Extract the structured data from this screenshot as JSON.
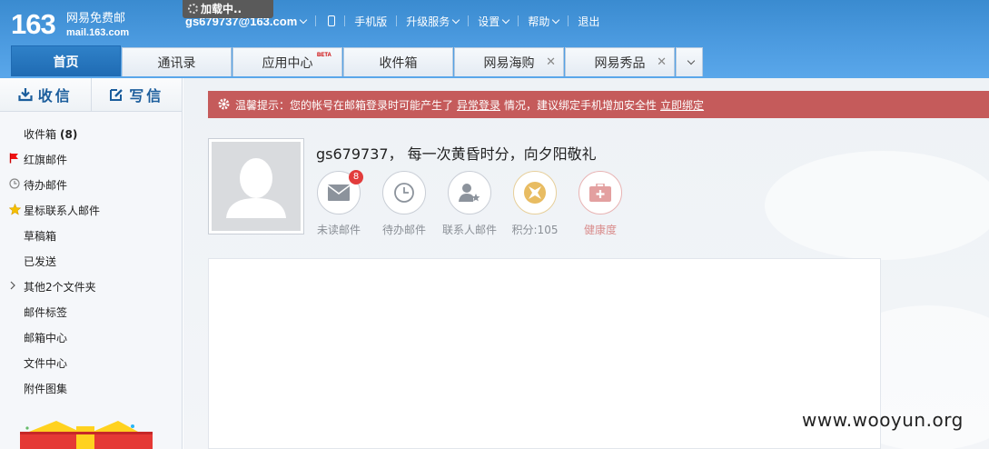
{
  "logo": {
    "number": "163",
    "name": "网易免费邮",
    "domain": "mail.163.com"
  },
  "loading": {
    "label": "加载中.."
  },
  "topnav": {
    "account": "gs679737@163.com",
    "mobile": "手机版",
    "upgrade": "升级服务",
    "settings": "设置",
    "help": "帮助",
    "logout": "退出"
  },
  "tabs": [
    {
      "label": "首页",
      "active": true
    },
    {
      "label": "通讯录"
    },
    {
      "label": "应用中心",
      "badge": "BETA"
    },
    {
      "label": "收件箱"
    },
    {
      "label": "网易海购",
      "closable": true
    },
    {
      "label": "网易秀品",
      "closable": true
    }
  ],
  "sidebar": {
    "receive": "收信",
    "compose": "写信",
    "folders": [
      {
        "label": "收件箱",
        "count": "(8)"
      },
      {
        "label": "红旗邮件"
      },
      {
        "label": "待办邮件"
      },
      {
        "label": "星标联系人邮件"
      },
      {
        "label": "草稿箱"
      },
      {
        "label": "已发送"
      },
      {
        "label": "其他2个文件夹"
      },
      {
        "label": "邮件标签"
      },
      {
        "label": "邮箱中心"
      },
      {
        "label": "文件中心"
      },
      {
        "label": "附件图集"
      }
    ]
  },
  "notice": {
    "prefix": "温馨提示：您的帐号在邮箱登录时可能产生了",
    "link1": "异常登录",
    "middle": "情况，建议绑定手机增加安全性",
    "link2": "立即绑定"
  },
  "profile": {
    "greeting": "gs679737， 每一次黄昏时分，向夕阳敬礼",
    "stats": [
      {
        "label": "未读邮件",
        "badge": "8"
      },
      {
        "label": "待办邮件"
      },
      {
        "label": "联系人邮件"
      },
      {
        "label": "积分:105"
      },
      {
        "label": "健康度"
      }
    ]
  },
  "watermark": "www.wooyun.org",
  "colors": {
    "header": "#3a8bd0",
    "notice": "#c55b5b",
    "active_tab": "#1f6bb3"
  }
}
